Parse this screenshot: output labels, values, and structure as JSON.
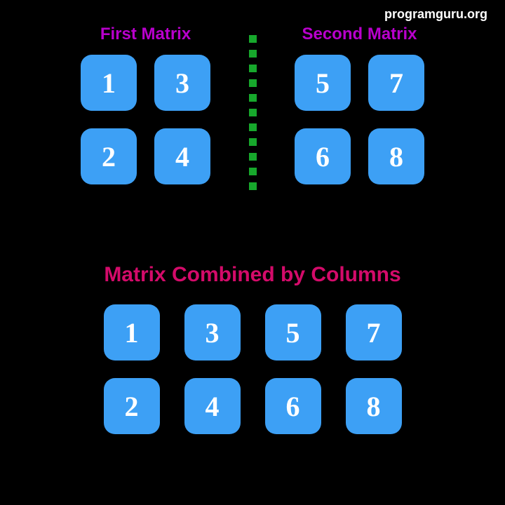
{
  "watermark": "programguru.org",
  "first_matrix": {
    "title": "First Matrix",
    "cells": [
      "1",
      "3",
      "2",
      "4"
    ]
  },
  "second_matrix": {
    "title": "Second Matrix",
    "cells": [
      "5",
      "7",
      "6",
      "8"
    ]
  },
  "combined_matrix": {
    "title": "Matrix Combined by Columns",
    "cells": [
      "1",
      "3",
      "5",
      "7",
      "2",
      "4",
      "6",
      "8"
    ]
  },
  "colors": {
    "cell_bg": "#3da0f5",
    "title_purple": "#b800cc",
    "title_pink": "#d40b6a",
    "divider_green": "#17a82c"
  }
}
